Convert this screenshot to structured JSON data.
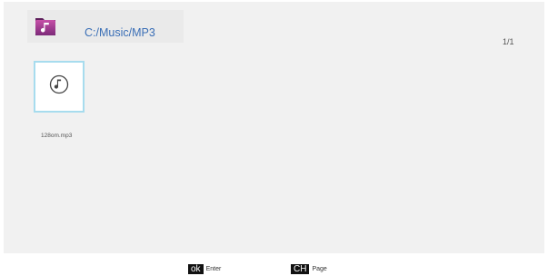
{
  "path": "C:/Music/MP3",
  "page_indicator": "1/1",
  "files": [
    {
      "name": "128om.mp3",
      "icon": "music-note-icon"
    }
  ],
  "footer": {
    "ok_key": "ok",
    "ok_label": "Enter",
    "ch_key": "CH",
    "ch_label": "Page"
  },
  "colors": {
    "path_text": "#3b6fb6",
    "folder": "#a0338a",
    "tile_border": "#a7dcee",
    "background": "#f1f1f1"
  }
}
